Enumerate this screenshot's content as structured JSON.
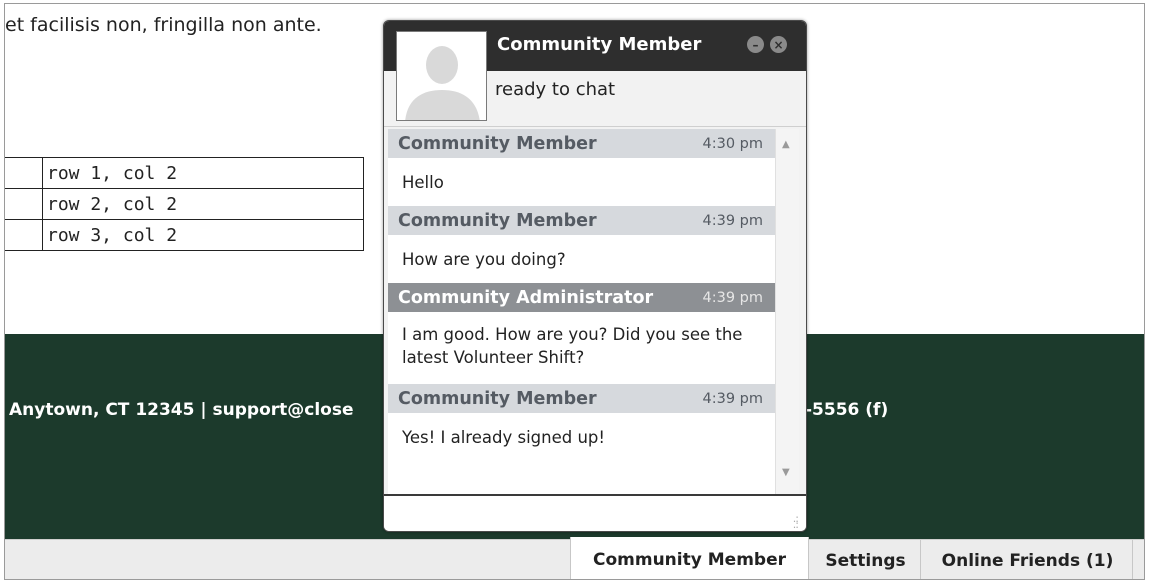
{
  "page": {
    "body_text": "et facilisis non, fringilla non ante.",
    "table": [
      [
        "",
        "row 1, col 2"
      ],
      [
        "",
        "row 2, col 2"
      ],
      [
        "",
        "row 3, col 2"
      ]
    ],
    "footer_left": "Anytown, CT 12345 | support@close",
    "footer_right": "-5556 (f)"
  },
  "chat": {
    "title": "Community Member",
    "status": "ready to chat",
    "minimize_icon": "minus-icon",
    "close_icon": "close-icon",
    "messages": [
      {
        "sender": "Community Member",
        "time": "4:30 pm",
        "text": "Hello",
        "admin": false
      },
      {
        "sender": "Community Member",
        "time": "4:39 pm",
        "text": "How are you doing?",
        "admin": false
      },
      {
        "sender": "Community Administrator",
        "time": "4:39 pm",
        "text": "I am good. How are you? Did you see the latest Volunteer Shift?",
        "admin": true
      },
      {
        "sender": "Community Member",
        "time": "4:39 pm",
        "text": "Yes! I already signed up!",
        "admin": false
      }
    ],
    "input_placeholder": ""
  },
  "bottom_bar": {
    "tabs": [
      {
        "label": "Community Member"
      },
      {
        "label": "Settings"
      },
      {
        "label": "Online Friends (1)"
      }
    ]
  },
  "colors": {
    "footer_bg": "#1c3a2c",
    "chat_header_bg": "#2e2e2e",
    "message_header_bg": "#d6d9dd",
    "admin_header_bg": "#8d9094"
  }
}
